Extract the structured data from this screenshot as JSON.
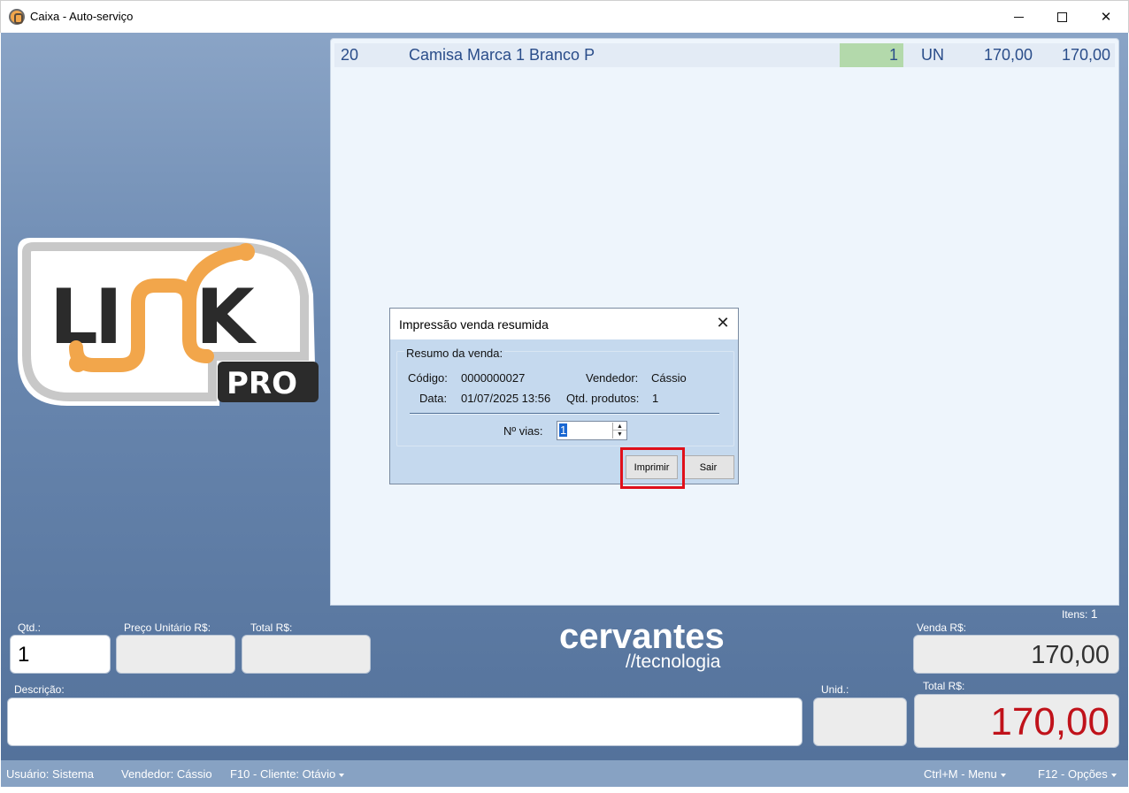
{
  "window": {
    "title": "Caixa - Auto-serviço",
    "controls": {
      "minimize_icon": "minimize-icon",
      "maximize_icon": "maximize-icon",
      "close_icon": "close-icon"
    }
  },
  "items_list": {
    "rows": [
      {
        "code": "20",
        "description": "Camisa Marca 1 Branco P",
        "qty": "1",
        "unit": "UN",
        "unit_price": "170,00",
        "total": "170,00"
      }
    ]
  },
  "logo": {
    "main": "LINK",
    "badge": "PRO"
  },
  "dialog": {
    "title": "Impressão venda resumida",
    "group_label": "Resumo da venda:",
    "codigo_label": "Código:",
    "codigo_value": "0000000027",
    "vendedor_label": "Vendedor:",
    "vendedor_value": "Cássio",
    "data_label": "Data:",
    "data_value": "01/07/2025 13:56",
    "qtd_label": "Qtd. produtos:",
    "qtd_value": "1",
    "vias_label": "Nº vias:",
    "vias_value": "1",
    "print_button": "Imprimir",
    "exit_button": "Sair"
  },
  "bottom": {
    "itens_label": "Itens:",
    "itens_value": "1",
    "qtd_label": "Qtd.:",
    "qtd_value": "1",
    "preco_label": "Preço Unitário R$:",
    "total_label": "Total R$:",
    "descricao_label": "Descrição:",
    "unid_label": "Unid.:",
    "venda_label": "Venda R$:",
    "venda_value": "170,00",
    "total_big_label": "Total R$:",
    "total_big_value": "170,00",
    "brand_main": "cervantes",
    "brand_sub": "//tecnologia"
  },
  "statusbar": {
    "usuario": "Usuário:  Sistema",
    "vendedor": "Vendedor:  Cássio",
    "cliente": "F10 - Cliente:  Otávio",
    "menu": "Ctrl+M - Menu",
    "opcoes": "F12 - Opções"
  },
  "colors": {
    "accent_red": "#c0121a",
    "qty_cell_green": "#b3d9ab",
    "highlight_red": "#e0101a",
    "logo_orange": "#f2a64b"
  }
}
